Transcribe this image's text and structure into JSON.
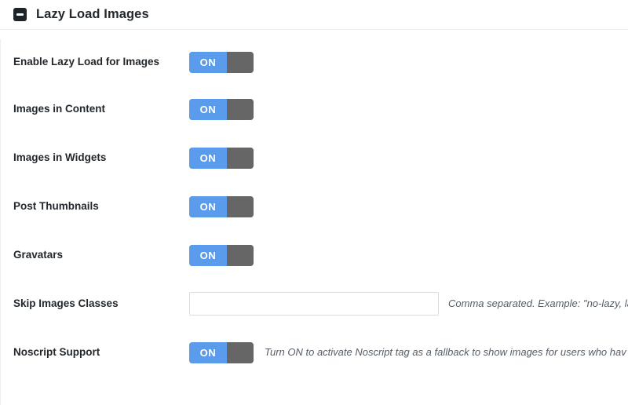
{
  "panel": {
    "title": "Lazy Load Images",
    "collapse_icon": "minus-square-icon"
  },
  "rows": [
    {
      "label": "Enable Lazy Load for Images",
      "control": "toggle",
      "toggle_label": "ON",
      "state": "on"
    },
    {
      "label": "Images in Content",
      "control": "toggle",
      "toggle_label": "ON",
      "state": "on"
    },
    {
      "label": "Images in Widgets",
      "control": "toggle",
      "toggle_label": "ON",
      "state": "on"
    },
    {
      "label": "Post Thumbnails",
      "control": "toggle",
      "toggle_label": "ON",
      "state": "on"
    },
    {
      "label": "Gravatars",
      "control": "toggle",
      "toggle_label": "ON",
      "state": "on"
    },
    {
      "label": "Skip Images Classes",
      "control": "text",
      "value": "",
      "placeholder": "",
      "hint": "Comma separated. Example: \"no-lazy, lazy"
    },
    {
      "label": "Noscript Support",
      "control": "toggle",
      "toggle_label": "ON",
      "state": "on",
      "hint": "Turn ON to activate Noscript tag as a fallback to show images for users who hav"
    }
  ],
  "colors": {
    "toggle_on": "#5a9ceb",
    "toggle_knob": "#666666",
    "text": "#23282d",
    "hint": "#555d66",
    "border": "#dcdcdc",
    "icon_bg": "#1d2327"
  }
}
